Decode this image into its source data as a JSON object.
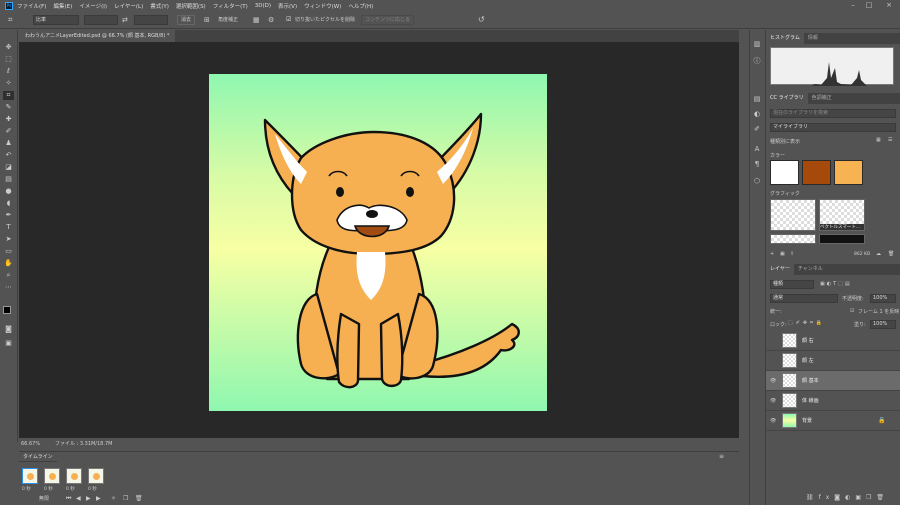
{
  "app": {
    "name": "Ps"
  },
  "menu": [
    "ファイル(F)",
    "編集(E)",
    "イメージ(I)",
    "レイヤー(L)",
    "書式(Y)",
    "選択範囲(S)",
    "フィルター(T)",
    "3D(D)",
    "表示(V)",
    "ウィンドウ(W)",
    "ヘルプ(H)"
  ],
  "options": {
    "ratio": "比率",
    "clear": "消去",
    "straighten": "角度補正",
    "delete_cropped": "切り抜いたピクセルを削除",
    "content_aware": "コンテンツに応じる"
  },
  "document": {
    "tab_title": "わわうんアニメLayerEdited.psd @ 66.7% (顔 基本, RGB/8) *"
  },
  "status": {
    "zoom": "66.67%",
    "file": "ファイル : 3.31M/18.7M"
  },
  "timeline": {
    "title": "タイムライン",
    "frames": [
      {
        "num": "1",
        "dur": "0 秒"
      },
      {
        "num": "2",
        "dur": "0 秒"
      },
      {
        "num": "3",
        "dur": "0 秒"
      },
      {
        "num": "4",
        "dur": "0 秒"
      }
    ],
    "loop": "無限"
  },
  "panels": {
    "histogram": {
      "tabs": [
        "ヒストグラム",
        "情報"
      ]
    },
    "libraries": {
      "tabs": [
        "CC ライブラリ",
        "色調補正"
      ],
      "search_placeholder": "現在のライブラリを検索",
      "library": "マイライブラリ",
      "view": "種類別に表示",
      "colors_label": "カラー",
      "graphics_label": "グラフィック",
      "graphic_name": "ベクトルスマート...",
      "size": "862 KB"
    },
    "layers": {
      "tabs": [
        "レイヤー",
        "チャンネル"
      ],
      "filter": "種類",
      "blend": "通常",
      "opacity_label": "不透明度:",
      "opacity": "100%",
      "lock_label": "ロック:",
      "fill_label": "塗り:",
      "fill": "100%",
      "unify_label": "統一:",
      "propagate": "フレーム 1 を反映",
      "items": [
        {
          "name": "顔 右"
        },
        {
          "name": "顔 左"
        },
        {
          "name": "顔 基本"
        },
        {
          "name": "体 線画"
        },
        {
          "name": "背景"
        }
      ]
    }
  },
  "colors": {
    "swatches": [
      "#ffffff",
      "#a54a0a",
      "#f7b252"
    ],
    "accent": "#31a8ff",
    "dog_orange": "#f6b052",
    "dog_dark": "#a04c12"
  }
}
